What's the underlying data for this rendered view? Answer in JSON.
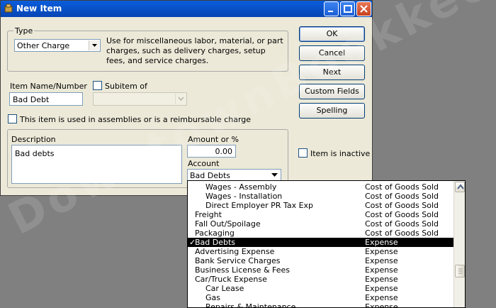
{
  "window": {
    "title": "New Item"
  },
  "type_group": {
    "legend": "Type",
    "selected": "Other Charge",
    "description": "Use for miscellaneous labor, material, or part charges, such as delivery charges, setup fees, and service charges."
  },
  "item": {
    "name_label": "Item Name/Number",
    "name_value": "Bad Debt",
    "subitem_label": "Subitem of",
    "subitem_value": "",
    "assemblies_label": "This item is used in assemblies or is a reimbursable charge"
  },
  "details": {
    "description_label": "Description",
    "description_value": "Bad debts",
    "amount_label": "Amount or %",
    "amount_value": "0.00",
    "account_label": "Account",
    "account_value": "Bad Debts",
    "inactive_label": "Item is inactive"
  },
  "buttons": {
    "ok": "OK",
    "cancel": "Cancel",
    "next": "Next",
    "custom_fields": "Custom Fields",
    "spelling": "Spelling"
  },
  "account_list": [
    {
      "name": "Wages - Assembly",
      "type": "Cost of Goods Sold",
      "indent": 1,
      "selected": false
    },
    {
      "name": "Wages - Installation",
      "type": "Cost of Goods Sold",
      "indent": 1,
      "selected": false
    },
    {
      "name": "Direct Employer PR Tax Exp",
      "type": "Cost of Goods Sold",
      "indent": 1,
      "selected": false
    },
    {
      "name": "Freight",
      "type": "Cost of Goods Sold",
      "indent": 0,
      "selected": false
    },
    {
      "name": "Fall Out/Spoilage",
      "type": "Cost of Goods Sold",
      "indent": 0,
      "selected": false
    },
    {
      "name": "Packaging",
      "type": "Cost of Goods Sold",
      "indent": 0,
      "selected": false
    },
    {
      "name": "Bad Debts",
      "type": "Expense",
      "indent": 0,
      "selected": true
    },
    {
      "name": "Advertising Expense",
      "type": "Expense",
      "indent": 0,
      "selected": false
    },
    {
      "name": "Bank Service Charges",
      "type": "Expense",
      "indent": 0,
      "selected": false
    },
    {
      "name": "Business License & Fees",
      "type": "Expense",
      "indent": 0,
      "selected": false
    },
    {
      "name": "Car/Truck Expense",
      "type": "Expense",
      "indent": 0,
      "selected": false
    },
    {
      "name": "Car Lease",
      "type": "Expense",
      "indent": 1,
      "selected": false
    },
    {
      "name": "Gas",
      "type": "Expense",
      "indent": 1,
      "selected": false
    },
    {
      "name": "Repairs & Maintenance",
      "type": "Expense",
      "indent": 1,
      "selected": false
    }
  ],
  "selected_mark": "✓",
  "watermark": "DowntownBookkeeping",
  "colors": {
    "titlebar": "#0a5ddc",
    "dialog_bg": "#ece9d8",
    "selection": "#000000",
    "desktop": "#808080"
  }
}
